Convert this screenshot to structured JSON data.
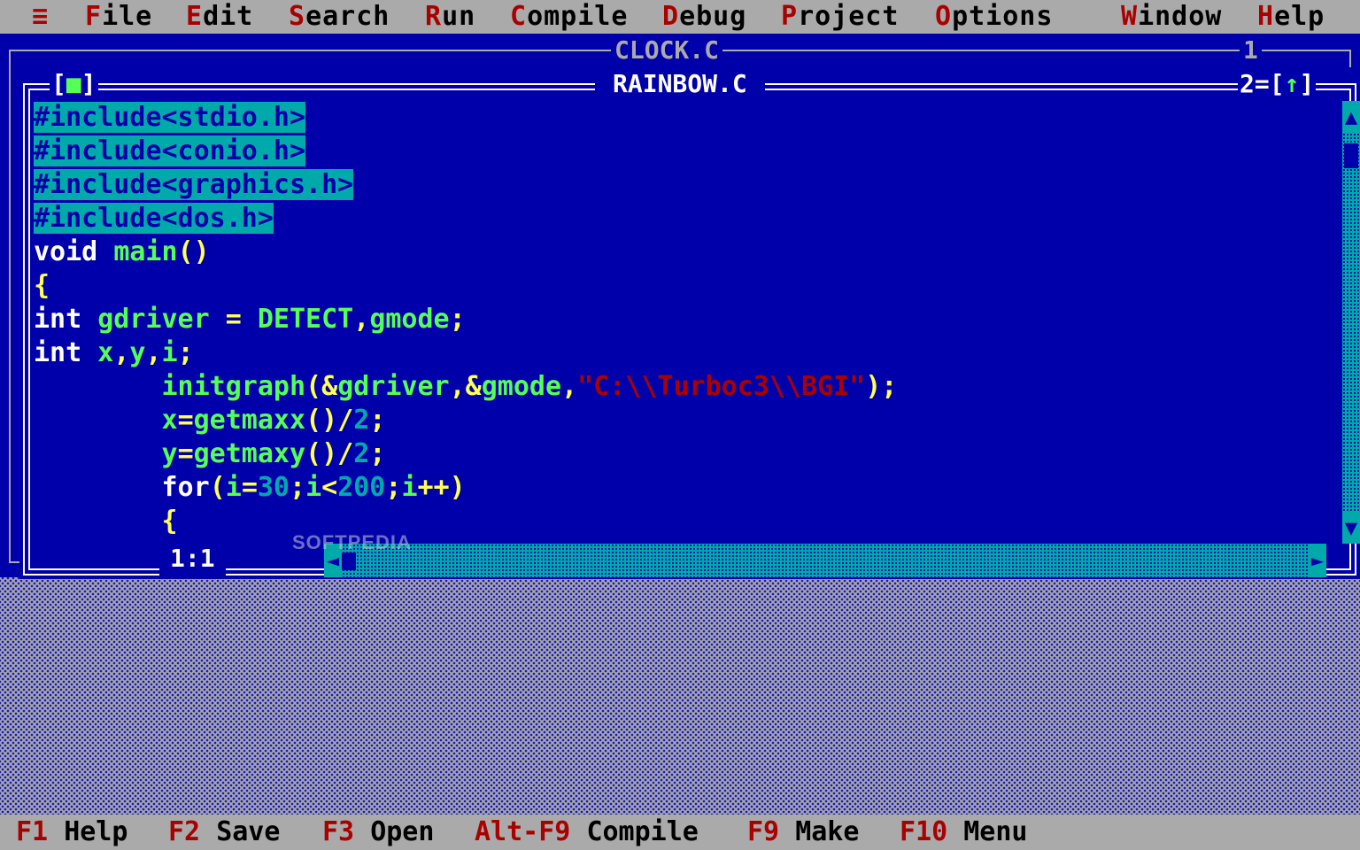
{
  "menu": {
    "system_icon": "≡",
    "items": [
      {
        "hot": "F",
        "rest": "ile"
      },
      {
        "hot": "E",
        "rest": "dit"
      },
      {
        "hot": "S",
        "rest": "earch"
      },
      {
        "hot": "R",
        "rest": "un"
      },
      {
        "hot": "C",
        "rest": "ompile"
      },
      {
        "hot": "D",
        "rest": "ebug"
      },
      {
        "hot": "P",
        "rest": "roject"
      },
      {
        "hot": "O",
        "rest": "ptions"
      },
      {
        "hot": "W",
        "rest": "indow"
      },
      {
        "hot": "H",
        "rest": "elp"
      }
    ]
  },
  "back_window": {
    "title": "CLOCK.C",
    "number": "1"
  },
  "front_window": {
    "close_left": "[",
    "close_mark": "■",
    "close_right": "]",
    "title": "RAINBOW.C",
    "number": "2",
    "zoom_left": "=[",
    "zoom_arrow": "↑",
    "zoom_right": "]",
    "cursor_position": "1:1"
  },
  "code_lines": [
    [
      "#include<stdio.h>"
    ],
    [
      "#include<conio.h>"
    ],
    [
      "#include<graphics.h>"
    ],
    [
      "#include<dos.h>"
    ],
    [
      "void",
      " ",
      "main",
      "()"
    ],
    [
      "{"
    ],
    [
      "int",
      " ",
      "gdriver",
      " = ",
      "DETECT",
      ",",
      "gmode",
      ";"
    ],
    [
      "int",
      " ",
      "x",
      ",",
      "y",
      ",",
      "i",
      ";"
    ],
    [
      "        ",
      "initgraph",
      "(&",
      "gdriver",
      ",&",
      "gmode",
      ",",
      "\"C:\\\\Turboc3\\\\BGI\"",
      ");"
    ],
    [
      "        ",
      "x",
      "=",
      "getmaxx",
      "()/",
      "2",
      ";"
    ],
    [
      "        ",
      "y",
      "=",
      "getmaxy",
      "()/",
      "2",
      ";"
    ],
    [
      "        ",
      "for",
      "(",
      "i",
      "=",
      "30",
      ";",
      "i",
      "<",
      "200",
      ";",
      "i",
      "++)"
    ],
    [
      "        ",
      "{"
    ]
  ],
  "scrollbars": {
    "up_arrow": "▲",
    "down_arrow": "▼",
    "left_arrow": "◄",
    "right_arrow": "►"
  },
  "watermark": "SOFTPEDIA",
  "status_hints": [
    {
      "key": "F1",
      "label": "Help"
    },
    {
      "key": "F2",
      "label": "Save"
    },
    {
      "key": "F3",
      "label": "Open"
    },
    {
      "key": "Alt-F9",
      "label": "Compile"
    },
    {
      "key": "F9",
      "label": "Make"
    },
    {
      "key": "F10",
      "label": "Menu"
    }
  ],
  "colors": {
    "editor_bg": "#0000aa",
    "menu_bg": "#aaaaaa",
    "hotkey": "#aa0000",
    "identifier": "#55ff55",
    "punctuation": "#ffff55",
    "selection": "#00aaaa",
    "string": "#aa0000"
  }
}
